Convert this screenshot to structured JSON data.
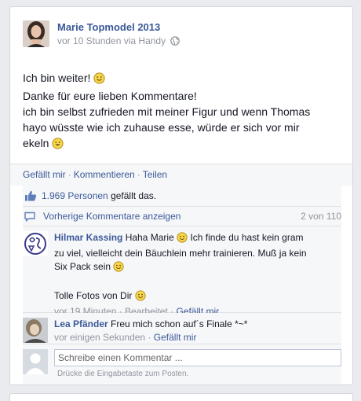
{
  "post": {
    "author": "Marie Topmodel 2013",
    "meta": "vor 10 Stunden via Handy",
    "lines": [
      "Ich bin weiter!",
      "Danke für eure lieben Kommentare!",
      "ich bin selbst zufrieden mit meiner Figur und wenn Thomas",
      "hayo wüsste wie ich zuhause esse, würde er sich vor mir",
      "ekeln"
    ]
  },
  "actions": {
    "like": "Gefällt mir",
    "comment": "Kommentieren",
    "share": "Teilen",
    "separator": "·"
  },
  "likes": {
    "count_link": "1.969 Personen",
    "suffix": "gefällt das."
  },
  "previous": {
    "link": "Vorherige Kommentare anzeigen",
    "count": "2 von 110"
  },
  "comments": [
    {
      "author": "Hilmar Kassing",
      "text_line1": "Haha Marie",
      "text_line1b": "Ich finde du hast kein gram",
      "text_line2": "zu viel, vielleicht dein Bäuchlein mehr trainieren. Muß ja kein",
      "text_line3": "Six Pack sein",
      "text_line4": "Tolle Fotos von Dir",
      "time": "vor 19 Minuten",
      "edited": "Bearbeitet",
      "like": "Gefällt mir"
    },
    {
      "author": "Lea Pfänder",
      "text": "Freu mich schon auf´s Finale *~*",
      "time": "vor einigen Sekunden",
      "like": "Gefällt mir"
    }
  ],
  "composer": {
    "placeholder": "Schreibe einen Kommentar ...",
    "hint": "Drücke die Eingabetaste zum Posten."
  },
  "colors": {
    "link": "#3b5998",
    "muted": "#90949c",
    "ufi_background": "#f6f7f9"
  }
}
